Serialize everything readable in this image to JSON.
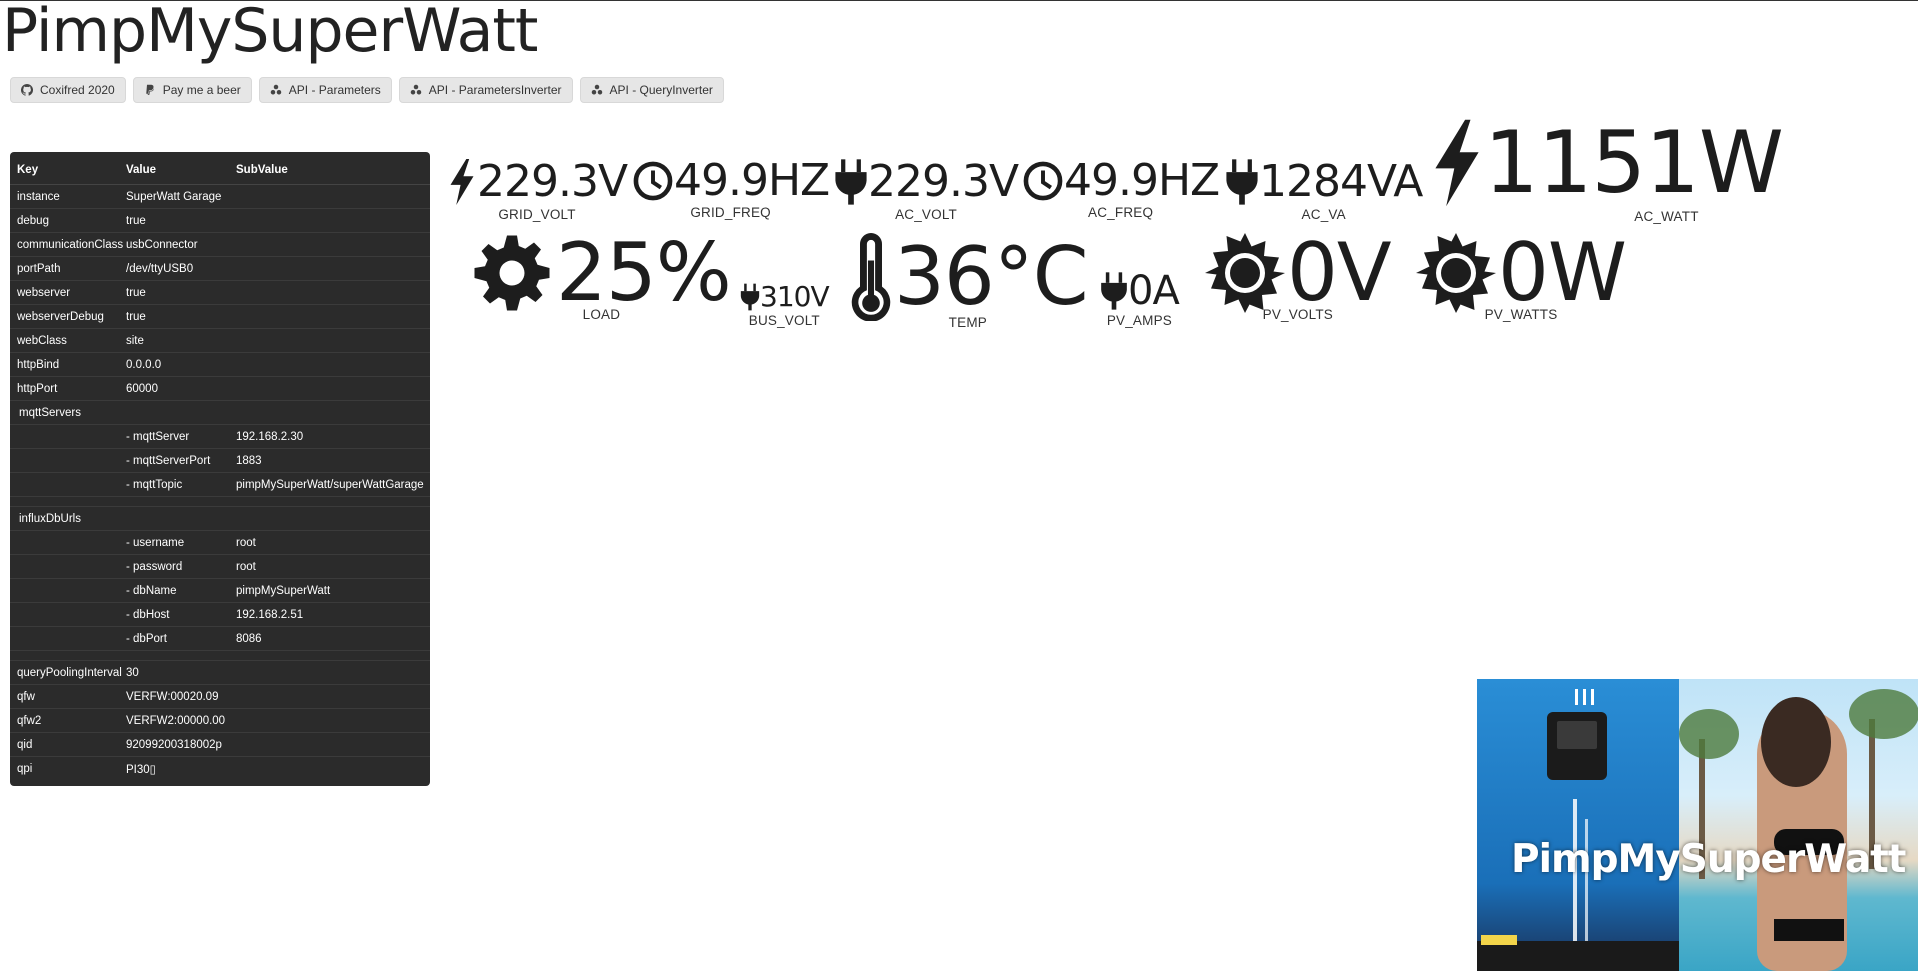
{
  "title": "PimpMySuperWatt",
  "links": [
    {
      "label": "Coxifred 2020",
      "icon": "github-icon"
    },
    {
      "label": "Pay me a beer",
      "icon": "paypal-icon"
    },
    {
      "label": "API - Parameters",
      "icon": "api-icon"
    },
    {
      "label": "API - ParametersInverter",
      "icon": "api-icon"
    },
    {
      "label": "API - QueryInverter",
      "icon": "api-icon"
    }
  ],
  "config": {
    "headers": {
      "key": "Key",
      "value": "Value",
      "subvalue": "SubValue"
    },
    "rows": [
      {
        "k": "instance",
        "v": "SuperWatt Garage",
        "s": ""
      },
      {
        "k": "debug",
        "v": "true",
        "s": ""
      },
      {
        "k": "communicationClass",
        "v": "usbConnector",
        "s": ""
      },
      {
        "k": "portPath",
        "v": "/dev/ttyUSB0",
        "s": ""
      },
      {
        "k": "webserver",
        "v": "true",
        "s": ""
      },
      {
        "k": "webserverDebug",
        "v": "true",
        "s": ""
      },
      {
        "k": "webClass",
        "v": "site",
        "s": ""
      },
      {
        "k": "httpBind",
        "v": "0.0.0.0",
        "s": ""
      },
      {
        "k": "httpPort",
        "v": "60000",
        "s": ""
      }
    ],
    "mqtt": {
      "label": "mqttServers",
      "rows": [
        {
          "v": "- mqttServer",
          "s": "192.168.2.30"
        },
        {
          "v": "- mqttServerPort",
          "s": "1883"
        },
        {
          "v": "- mqttTopic",
          "s": "pimpMySuperWatt/superWattGarage"
        }
      ]
    },
    "influx": {
      "label": "influxDbUrls",
      "rows": [
        {
          "v": "- username",
          "s": "root"
        },
        {
          "v": "- password",
          "s": "root"
        },
        {
          "v": "- dbName",
          "s": "pimpMySuperWatt"
        },
        {
          "v": "- dbHost",
          "s": "192.168.2.51"
        },
        {
          "v": "- dbPort",
          "s": "8086"
        }
      ]
    },
    "tail": [
      {
        "k": "queryPoolingInterval",
        "v": "30"
      },
      {
        "k": "qfw",
        "v": "VERFW:00020.09"
      },
      {
        "k": "qfw2",
        "v": "VERFW2:00000.00"
      },
      {
        "k": "qid",
        "v": "92099200318002p"
      },
      {
        "k": "qpi",
        "v": "PI30▯"
      }
    ]
  },
  "gauges": {
    "grid_volt": {
      "value": "229.3V",
      "label": "GRID_VOLT",
      "icon": "bolt-icon"
    },
    "grid_freq": {
      "value": "49.9HZ",
      "label": "GRID_FREQ",
      "icon": "clock-icon"
    },
    "ac_volt": {
      "value": "229.3V",
      "label": "AC_VOLT",
      "icon": "plug-icon"
    },
    "ac_freq": {
      "value": "49.9HZ",
      "label": "AC_FREQ",
      "icon": "clock-icon"
    },
    "ac_va": {
      "value": "1284VA",
      "label": "AC_VA",
      "icon": "plug-icon"
    },
    "ac_watt": {
      "value": "1151W",
      "label": "AC_WATT",
      "icon": "bolt-icon"
    },
    "load": {
      "value": "25%",
      "label": "LOAD",
      "icon": "gear-icon"
    },
    "bus_volt": {
      "value": "310V",
      "label": "BUS_VOLT",
      "icon": "plug-icon"
    },
    "temp": {
      "value": "36°C",
      "label": "TEMP",
      "icon": "thermometer-icon"
    },
    "pv_amps": {
      "value": "0A",
      "label": "PV_AMPS",
      "icon": "plug-icon"
    },
    "pv_volts": {
      "value": "0V",
      "label": "PV_VOLTS",
      "icon": "sun-icon"
    },
    "pv_watts": {
      "value": "0W",
      "label": "PV_WATTS",
      "icon": "sun-icon"
    }
  },
  "promo": {
    "text": "PimpMySuperWatt"
  }
}
